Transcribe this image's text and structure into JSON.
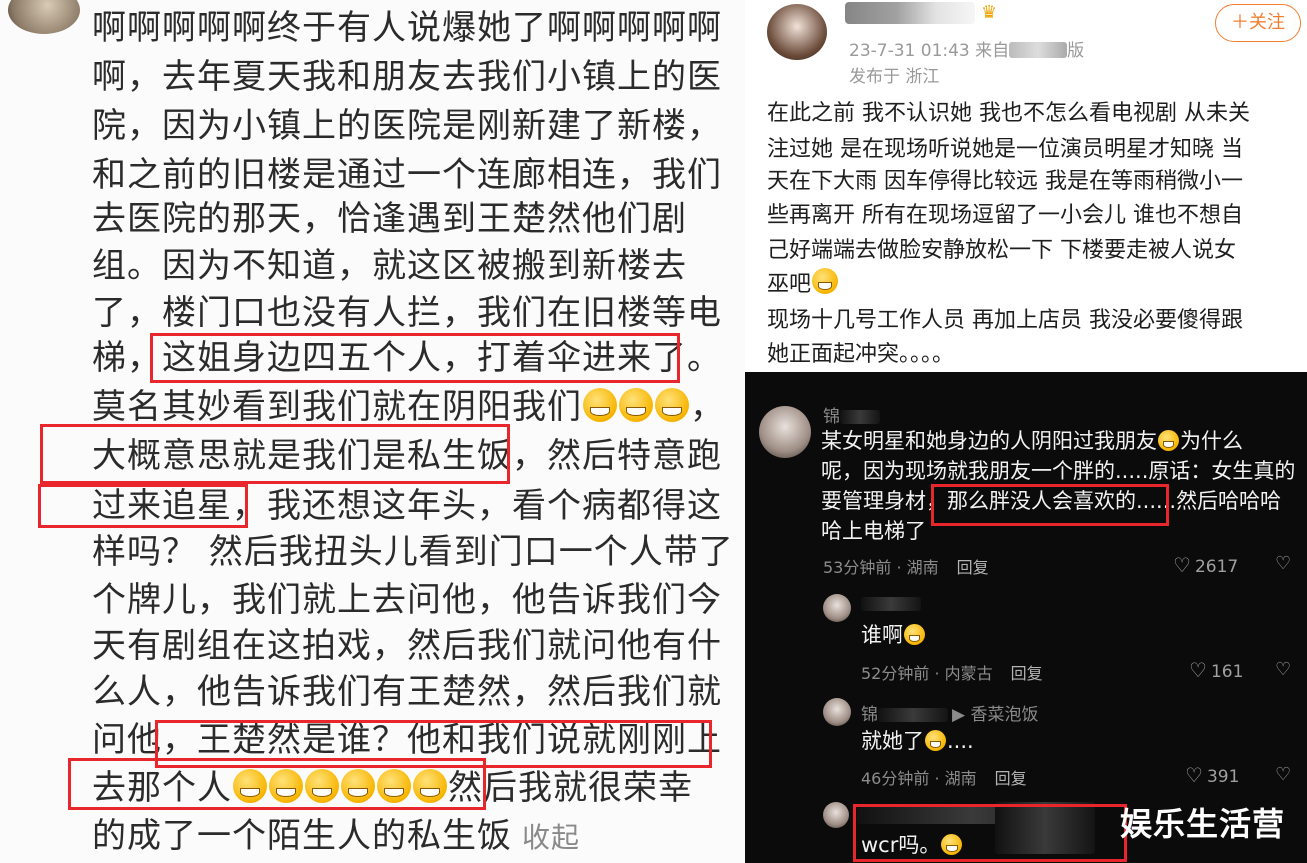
{
  "left_post": {
    "lines": [
      "啊啊啊啊啊终于有人说爆她了啊啊啊啊啊",
      "啊，去年夏天我和朋友去我们小镇上的医",
      "院，因为小镇上的医院是刚新建了新楼，",
      "和之前的旧楼是通过一个连廊相连，我们",
      "去医院的那天，恰逢遇到王楚然他们剧",
      "组。因为不知道，就这区被搬到新楼去",
      "了，楼门口也没有人拦，我们在旧楼等电",
      "梯，这姐身边四五个人，打着伞进来了。",
      "莫名其妙看到我们就在阴阳我们",
      "大概意思就是我们是私生饭，然后特意跑",
      "过来追星，我还想这年头，看个病都得这",
      "样吗？ 然后我扭头儿看到门口一个人带了",
      "个牌儿，我们就上去问他，他告诉我们今",
      "天有剧组在这拍戏，然后我们就问他有什",
      "么人，他告诉我们有王楚然，然后我们就",
      "问他，王楚然是谁？他和我们说就刚刚上",
      "去那个人",
      "然后我就很荣幸",
      "的成了一个陌生人的私生饭"
    ],
    "line9_tail": "，",
    "more_label": "收起"
  },
  "right_post": {
    "follow_label": "＋关注",
    "timestamp": "23-7-31 01:43",
    "source": "来自",
    "source_tail": "版",
    "location": "发布于 浙江",
    "lines": [
      "在此之前 我不认识她 我也不怎么看电视剧 从未关",
      "注过她 是在现场听说她是一位演员明星才知晓 当",
      "天在下大雨 因车停得比较远 我是在等雨稍微小一",
      "些再离开 所有在现场逗留了一小会儿 谁也不想自",
      "己好端端去做脸安静放松一下 下楼要走被人说女",
      "巫吧",
      "现场十几号工作人员 再加上店员 我没必要傻得跟",
      "她正面起冲突。。。。"
    ]
  },
  "comments": [
    {
      "name": "锦",
      "lines": [
        "某女明星和她身边的人阴阳过我朋友",
        "为什么",
        "呢，因为现场就我朋友一个胖的.....原话：女生真的",
        "要管理身材，",
        "那么胖没人会喜欢的......",
        "然后哈哈哈",
        "哈上电梯了"
      ],
      "time": "53分钟前 · 湖南",
      "reply": "回复",
      "likes": "2617"
    },
    {
      "name": "",
      "text": "谁啊",
      "time": "52分钟前 · 内蒙古",
      "reply": "回复",
      "likes": "161"
    },
    {
      "name": "锦",
      "reply_to": "▶ 香菜泡饭",
      "text": "就她了",
      "text_tail": "....",
      "time": "46分钟前 · 湖南",
      "reply": "回复",
      "likes": "391"
    },
    {
      "name": "",
      "text": "wcr吗。"
    }
  ],
  "watermark": "娱乐生活营",
  "colors": {
    "highlight_box": "#e8262b",
    "follow": "#f27f30",
    "dark_bg": "#0b0b0b"
  }
}
